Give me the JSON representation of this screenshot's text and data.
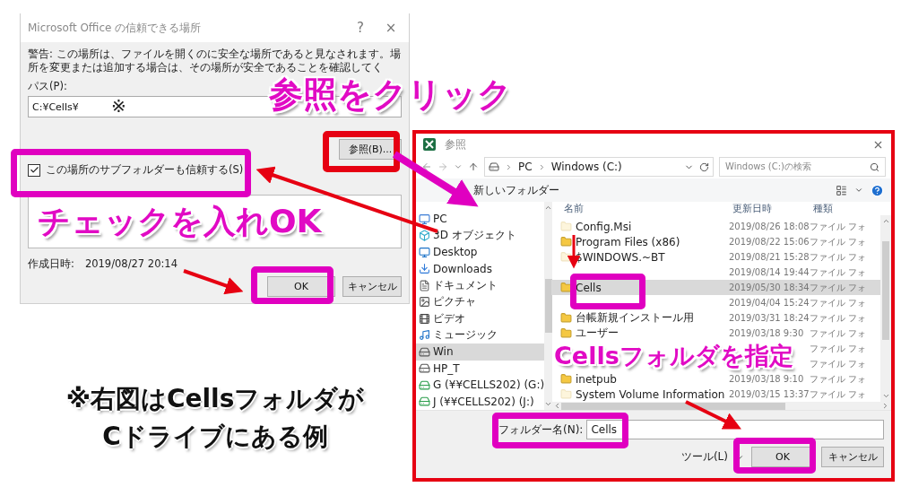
{
  "trust_dialog": {
    "title": "Microsoft Office の信頼できる場所",
    "help": "?",
    "close": "×",
    "warning": "警告: この場所は、ファイルを開くのに安全な場所であると見なされます。場所を変更または追加する場合は、その場所が安全であることを確認してく",
    "path_label": "パス(P):",
    "path_value": "C:¥Cells¥",
    "path_mark": "※",
    "browse_button": "参照(B)...",
    "subfolder_checkbox": {
      "label": "この場所のサブフォルダーも信頼する(S)",
      "checked": true
    },
    "created_label": "作成日時:",
    "created_value": "2019/08/27 20:14",
    "buttons": [
      "OK",
      "キャンセル"
    ]
  },
  "browse_dialog": {
    "title": "参照",
    "breadcrumb": [
      "PC",
      "Windows (C:)"
    ],
    "search_placeholder": "Windows (C:)の検索",
    "new_folder": "新しいフォルダー",
    "sidebar": [
      {
        "kind": "pc",
        "label": "PC",
        "selected": false
      },
      {
        "kind": "cube",
        "label": "3D オブジェクト",
        "selected": false
      },
      {
        "kind": "desktop",
        "label": "Desktop",
        "selected": false
      },
      {
        "kind": "download",
        "label": "Downloads",
        "selected": false
      },
      {
        "kind": "document",
        "label": "ドキュメント",
        "selected": false
      },
      {
        "kind": "picture",
        "label": "ピクチャ",
        "selected": false
      },
      {
        "kind": "video",
        "label": "ビデオ",
        "selected": false
      },
      {
        "kind": "music",
        "label": "ミュージック",
        "selected": false
      },
      {
        "kind": "drive",
        "label": "Win",
        "selected": true
      },
      {
        "kind": "drive",
        "label": "HP_T",
        "selected": false
      },
      {
        "kind": "network",
        "label": "G (¥¥CELLS202) (G:)",
        "selected": false
      },
      {
        "kind": "network",
        "label": "J (¥¥CELLS202) (J:)",
        "selected": false
      }
    ],
    "columns": [
      "名前",
      "更新日時",
      "種類"
    ],
    "rows": [
      {
        "name": "Config.Msi",
        "date": "2019/08/26 18:08",
        "type": "ファイル フォ",
        "hidden": true,
        "selected": false
      },
      {
        "name": "Program Files (x86)",
        "date": "2019/08/22 15:06",
        "type": "ファイル フォ",
        "hidden": false,
        "selected": false
      },
      {
        "name": "$WINDOWS.~BT",
        "date": "2019/08/21 15:28",
        "type": "ファイル フォ",
        "hidden": true,
        "selected": false
      },
      {
        "date": "2019/08/14 19:44",
        "type": "ファイル フォ",
        "selected": false
      },
      {
        "name": "Cells",
        "date": "2019/05/30 18:34",
        "type": "ファイル フォ",
        "hidden": false,
        "selected": true
      },
      {
        "date": "2019/04/04 15:24",
        "type": "ファイル フォ",
        "selected": false
      },
      {
        "name": "台帳新規インストール用",
        "date": "2019/03/31 18:24",
        "type": "ファイル フォ",
        "hidden": false,
        "selected": false
      },
      {
        "name": "ユーザー",
        "date": "2019/03/18 9:30",
        "type": "ファイル フォ",
        "hidden": false,
        "selected": false
      },
      {
        "type": "ファイル フォ",
        "selected": false
      },
      {
        "type": "ファイル フォ",
        "selected": false
      },
      {
        "name": "inetpub",
        "date": "2019/03/18 9:10",
        "type": "ファイル フォ",
        "hidden": false,
        "selected": false
      },
      {
        "name": "System Volume Information",
        "date": "2019/03/15 13:37",
        "type": "ファイル フォ",
        "hidden": true,
        "selected": false
      }
    ],
    "folder_label": "フォルダー名(N):",
    "folder_value": "Cells",
    "tools": "ツール(L)",
    "buttons": [
      "OK",
      "キャンセル"
    ]
  },
  "callouts": [
    {
      "kind": "browse",
      "text": "参照をクリック"
    },
    {
      "kind": "check",
      "text": "チェックを入れOK"
    },
    {
      "kind": "folder",
      "text": "Cellsフォルダを指定"
    }
  ],
  "note": [
    "※右図はCellsフォルダが",
    "Cドライブにある例"
  ]
}
